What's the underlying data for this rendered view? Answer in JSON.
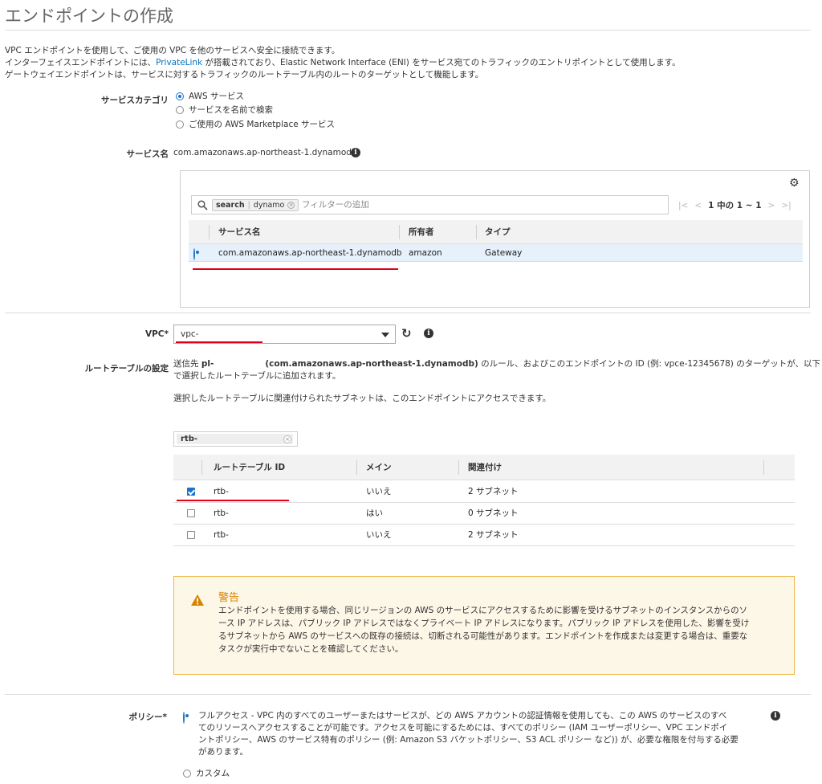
{
  "page": {
    "title": "エンドポイントの作成",
    "intro_line1": "VPC エンドポイントを使用して、ご使用の VPC を他のサービスへ安全に接続できます。",
    "intro_line2_pre": "インターフェイスエンドポイントには、",
    "intro_line2_link": "PrivateLink",
    "intro_line2_post": " が搭載されており、Elastic Network Interface (ENI) をサービス宛てのトラフィックのエントリポイントとして使用します。",
    "intro_line3": "ゲートウェイエンドポイントは、サービスに対するトラフィックのルートテーブル内のルートのターゲットとして機能します。"
  },
  "service_category": {
    "label": "サービスカテゴリ",
    "options": [
      "AWS サービス",
      "サービスを名前で検索",
      "ご使用の AWS Marketplace サービス"
    ],
    "selected_index": 0
  },
  "service_name": {
    "label": "サービス名",
    "value": "com.amazonaws.ap-northeast-1.dynamodb"
  },
  "service_table": {
    "search_token_key": "search",
    "search_token_value": "dynamo",
    "search_placeholder": "フィルターの追加",
    "pager_text": "1 中の 1 ~ 1",
    "columns": [
      "サービス名",
      "所有者",
      "タイプ"
    ],
    "rows": [
      {
        "name": "com.amazonaws.ap-northeast-1.dynamodb",
        "owner": "amazon",
        "type": "Gateway",
        "selected": true
      }
    ]
  },
  "vpc": {
    "label": "VPC*",
    "value": "vpc-"
  },
  "route_table": {
    "label": "ルートテーブルの設定",
    "desc_pre": "送信先 ",
    "desc_prefix_list": "pl-",
    "desc_service": "(com.amazonaws.ap-northeast-1.dynamodb)",
    "desc_line1_post": " のルール、およびこのエンドポイントの ID (例: vpce-12345678) のターゲットが、以下",
    "desc_line2": "で選択したルートテーブルに追加されます。",
    "note": "選択したルートテーブルに関連付けられたサブネットは、このエンドポイントにアクセスできます。",
    "filter_value": "rtb-",
    "columns": [
      "ルートテーブル ID",
      "メイン",
      "関連付け"
    ],
    "rows": [
      {
        "id": "rtb-",
        "main": "いいえ",
        "assoc": "2 サブネット",
        "checked": true
      },
      {
        "id": "rtb-",
        "main": "はい",
        "assoc": "0 サブネット",
        "checked": false
      },
      {
        "id": "rtb-",
        "main": "いいえ",
        "assoc": "2 サブネット",
        "checked": false
      }
    ]
  },
  "warning": {
    "title": "警告",
    "line1": "エンドポイントを使用する場合、同じリージョンの AWS のサービスにアクセスするために影響を受けるサブネットのインスタンスからのソ",
    "line2": "ース IP アドレスは、パブリック IP アドレスではなくプライベート IP アドレスになります。パブリック IP アドレスを使用した、影響を受け",
    "line3": "るサブネットから AWS のサービスへの既存の接続は、切断される可能性があります。エンドポイントを作成または変更する場合は、重要な",
    "line4": "タスクが実行中でないことを確認してください。"
  },
  "policy": {
    "label": "ポリシー*",
    "full_line1": "フルアクセス - VPC 内のすべてのユーザーまたはサービスが、どの AWS アカウントの認証情報を使用しても、この AWS のサービスのすべ",
    "full_line2": "てのリソースへアクセスすることが可能です。アクセスを可能にするためには、すべてのポリシー (IAM ユーザーポリシー、VPC エンドポイ",
    "full_line3": "ントポリシー、AWS のサービス特有のポリシー (例: Amazon S3 バケットポリシー、S3 ACL ポリシー など)) が、必要な権限を付与する必要",
    "full_line4": "があります。",
    "custom": "カスタム",
    "selected_index": 0
  },
  "colors": {
    "accent": "#1a73c9",
    "link": "#0073bb",
    "highlight": "#e0001b",
    "warning_border": "#ecb548",
    "warning_title": "#d98200"
  }
}
